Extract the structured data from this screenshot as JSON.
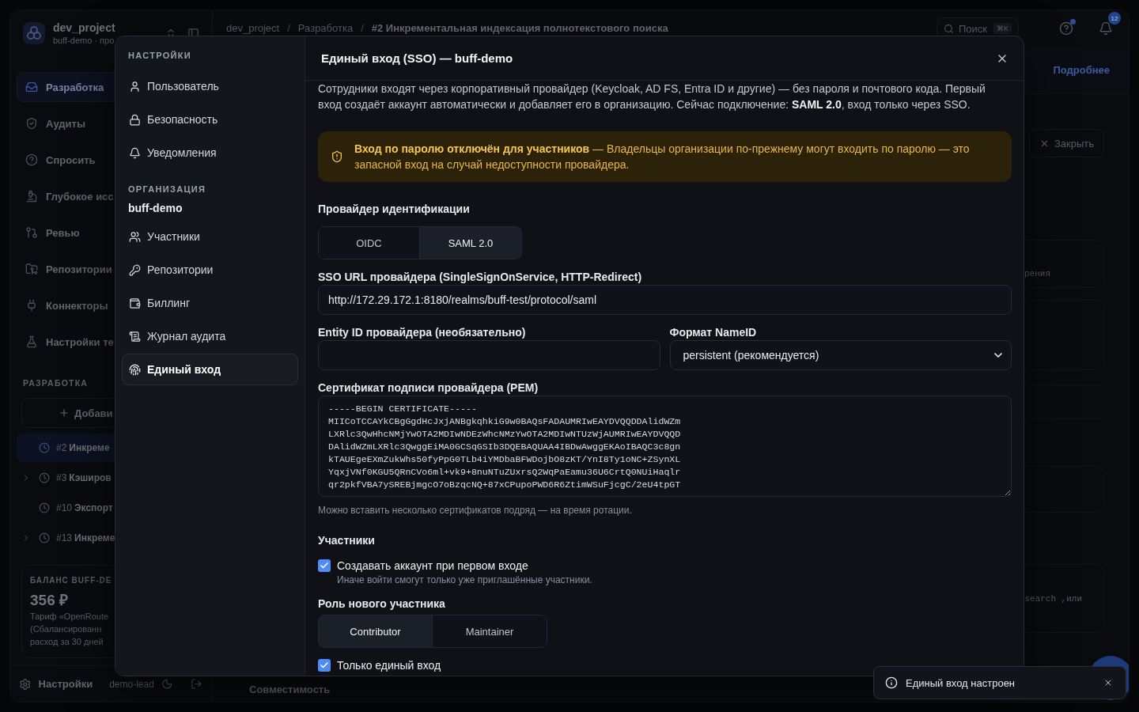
{
  "background": {
    "sidebar": {
      "project_name": "dev_project",
      "project_subtitle": "buff-demo · про",
      "nav": [
        {
          "label": "Разработка",
          "selected": true
        },
        {
          "label": "Аудиты",
          "selected": false
        },
        {
          "label": "Спросить",
          "selected": false
        },
        {
          "label": "Глубокое исс",
          "selected": false
        },
        {
          "label": "Ревью",
          "selected": false
        },
        {
          "label": "Репозитории",
          "selected": false
        },
        {
          "label": "Коннекторы",
          "selected": false
        },
        {
          "label": "Настройки те",
          "selected": false
        }
      ],
      "section_title": "РАЗРАБОТКА",
      "add_button": "Добави",
      "tasks": [
        {
          "number": "#2",
          "title": "Инкреме",
          "selected": true,
          "expandable": false
        },
        {
          "number": "#3",
          "title": "Кэширов",
          "selected": false,
          "expandable": true
        },
        {
          "number": "#10",
          "title": "Экспорт",
          "selected": false,
          "expandable": false
        },
        {
          "number": "#13",
          "title": "Инкреме",
          "selected": false,
          "expandable": true
        }
      ],
      "balance": {
        "title": "БАЛАНС BUFF-DE",
        "amount": "356 ₽",
        "lines": [
          "Тариф «OpenRoute",
          "(Сбалансированн",
          "расход за 30 дней"
        ]
      },
      "footer": {
        "settings": "Настройки",
        "user": "demo-lead"
      }
    },
    "top_bar": {
      "breadcrumbs": [
        "dev_project",
        "Разработка",
        "#2 Инкрементальная индексация полнотекстового поиска"
      ],
      "separator": "/",
      "search": {
        "placeholder": "Поиск",
        "shortcut": "⌘K"
      },
      "notification_count": "12"
    },
    "main": {
      "more_link": "Подробнее",
      "close_button": "Закрыть",
      "card_texts": [
        "рения",
        "search ,или"
      ],
      "bottom_tab": "Совместимость"
    }
  },
  "dialog": {
    "title": "Единый вход (SSO) — buff-demo",
    "nav_sections": [
      {
        "title": "НАСТРОЙКИ",
        "items": [
          {
            "label": "Пользователь",
            "selected": false
          },
          {
            "label": "Безопасность",
            "selected": false
          },
          {
            "label": "Уведомления",
            "selected": false
          }
        ]
      },
      {
        "title": "ОРГАНИЗАЦИЯ",
        "subtitle": "buff-demo",
        "items": [
          {
            "label": "Участники",
            "selected": false
          },
          {
            "label": "Репозитории",
            "selected": false
          },
          {
            "label": "Биллинг",
            "selected": false
          },
          {
            "label": "Журнал аудита",
            "selected": false
          },
          {
            "label": "Единый вход",
            "selected": true
          }
        ]
      }
    ],
    "description": "Сотрудники входят через корпоративный провайдер (Keycloak, AD FS, Entra ID и другие) — без пароля и почтового кода. Первый вход создаёт аккаунт автоматически и добавляет его в организацию. Сейчас подключение: **SAML 2.0**, вход только через SSO.",
    "alert": {
      "text": "**Вход по паролю отключён для участников** — Владельцы организации по-прежнему могут входить по паролю — это запасной вход на случай недоступности провайдера."
    },
    "provider": {
      "label": "Провайдер идентификации",
      "options": [
        {
          "label": "OIDC",
          "selected": false
        },
        {
          "label": "SAML 2.0",
          "selected": true
        }
      ]
    },
    "sso_url": {
      "label": "SSO URL провайдера (SingleSignOnService, HTTP-Redirect)",
      "value": "http://172.29.172.1:8180/realms/buff-test/protocol/saml"
    },
    "entity_id": {
      "label": "Entity ID провайдера (необязательно)"
    },
    "nameid_format": {
      "label": "Формат NameID",
      "value": "persistent (рекомендуется)"
    },
    "certificate": {
      "label": "Сертификат подписи провайдера (PEM)",
      "lines": [
        "-----BEGIN CERTIFICATE-----",
        "MIICoTCCAYkCBgGgdHcJxjANBgkqhkiG9w0BAQsFADAUMRIwEAYDVQQDDAlidWZm",
        "LXRlc3QwHhcNMjYwOTA2MDIwNDEzWhcNMzYwOTA2MDIwNTUzWjAUMRIwEAYDVQQD",
        "DAlidWZmLXRlc3QwggEiMA0GCSqGSIb3DQEBAQUAA4IBDwAwggEKAoIBAQC3c8gn",
        "kTAUEgeEXmZukWhs50fyPpG0TLb4iYMDbaBFWDojbO8zKT/YnI8Ty1oNC+ZSynXL",
        "YqxjVNf0KGU5QRnCVo6ml+vk9+8nuNTuZUxrsQ2WqPaEamu36U6CrtQ0NUiHaqlr",
        "qr2pkfVBA7ySREBjmgcO7oBzqcNQ+87xCPupoPWD6R6ZtimWSuFjcgC/2eU4tpGT"
      ],
      "hint": "Можно вставить несколько сертификатов подряд — на время ротации."
    },
    "members": {
      "title": "Участники",
      "create_account": {
        "label": "Создавать аккаунт при первом входе",
        "hint": "Иначе войти смогут только уже приглашённые участники.",
        "checked": true
      },
      "role": {
        "label": "Роль нового участника",
        "options": [
          {
            "label": "Contributor",
            "selected": true
          },
          {
            "label": "Maintainer",
            "selected": false
          }
        ]
      },
      "sso_only": {
        "label": "Только единый вход",
        "checked": true
      }
    }
  },
  "toast": {
    "text": "Единый вход настроен"
  }
}
